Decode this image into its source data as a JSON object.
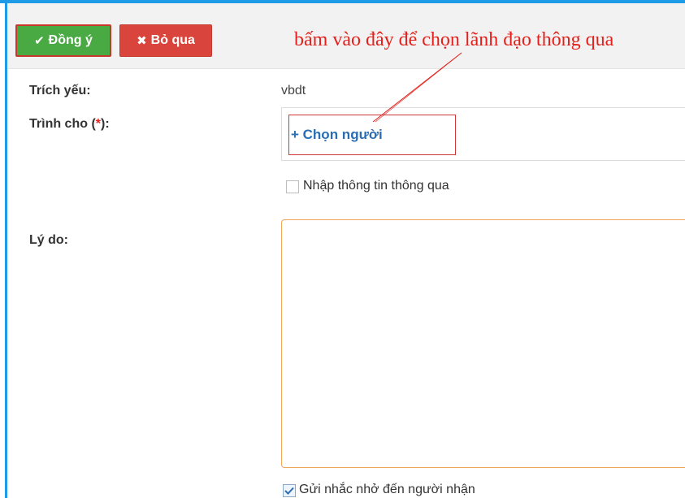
{
  "toolbar": {
    "ok_icon": "check-icon",
    "ok_label": "Đồng ý",
    "cancel_icon": "x-icon",
    "cancel_label": "Bỏ qua"
  },
  "annotation": {
    "text": "bấm vào đây để chọn lãnh đạo thông qua",
    "color": "#e3201b"
  },
  "form": {
    "summary_label": "Trích yếu:",
    "summary_value": "vbdt",
    "submit_to_label": "Trình cho (",
    "submit_to_required": "*",
    "submit_to_label_end": "):",
    "pick_person_link": "+ Chọn người",
    "enter_approval_info_label": "Nhập thông tin thông qua",
    "enter_approval_info_checked": false,
    "reason_label": "Lý do:",
    "reason_value": "",
    "send_reminder_label": "Gửi nhắc nhở đến người nhận",
    "send_reminder_checked": true
  },
  "colors": {
    "frame_border": "#1e9be6",
    "ok_button": "#49a942",
    "cancel_button": "#d9453c",
    "link": "#2a6db3",
    "textarea_focus": "#f2a65a"
  }
}
